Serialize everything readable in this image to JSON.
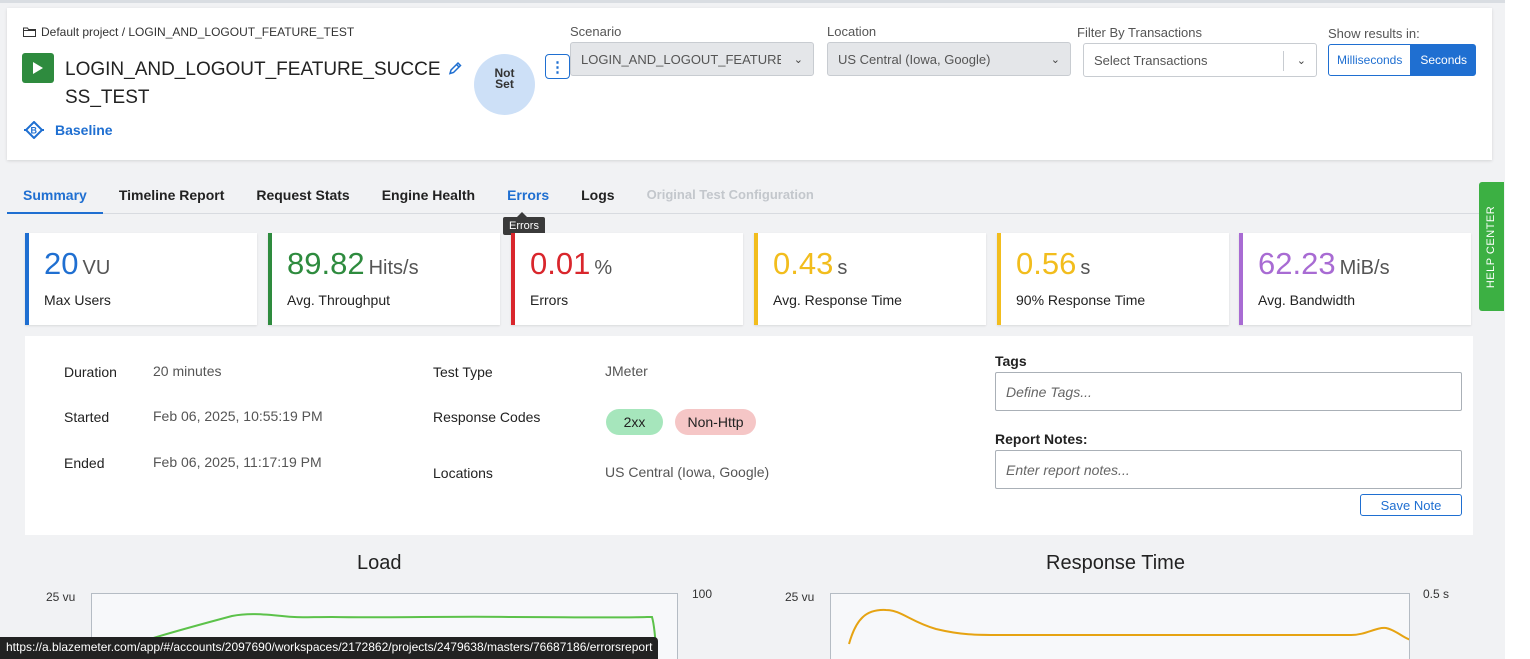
{
  "breadcrumb": "Default project / LOGIN_AND_LOGOUT_FEATURE_TEST",
  "test": {
    "title": "LOGIN_AND_LOGOUT_FEATURE_SUCCESS_TEST",
    "status_line1": "Not",
    "status_line2": "Set",
    "kebab": "⋮",
    "baseline_label": "Baseline"
  },
  "filters": {
    "scenario_label": "Scenario",
    "scenario_value": "LOGIN_AND_LOGOUT_FEATURE_TEST",
    "location_label": "Location",
    "location_value": "US Central (Iowa, Google)",
    "transactions_label": "Filter By Transactions",
    "transactions_placeholder": "Select Transactions",
    "units_label": "Show results in:",
    "units": [
      "Milliseconds",
      "Seconds"
    ],
    "units_selected": "Seconds"
  },
  "tabs": [
    {
      "label": "Summary",
      "state": "active"
    },
    {
      "label": "Timeline Report",
      "state": "normal"
    },
    {
      "label": "Request Stats",
      "state": "normal"
    },
    {
      "label": "Engine Health",
      "state": "normal"
    },
    {
      "label": "Errors",
      "state": "hover"
    },
    {
      "label": "Logs",
      "state": "normal"
    },
    {
      "label": "Original Test Configuration",
      "state": "disabled"
    }
  ],
  "tooltip": "Errors",
  "kpis": [
    {
      "value": "20",
      "unit": "VU",
      "label": "Max Users",
      "color": "#1f6fd1"
    },
    {
      "value": "89.82",
      "unit": "Hits/s",
      "label": "Avg. Throughput",
      "color": "#2e8b3e"
    },
    {
      "value": "0.01",
      "unit": "%",
      "label": "Errors",
      "color": "#d9262c"
    },
    {
      "value": "0.43",
      "unit": "s",
      "label": "Avg. Response Time",
      "color": "#f2bd1d"
    },
    {
      "value": "0.56",
      "unit": "s",
      "label": "90% Response Time",
      "color": "#f2bd1d"
    },
    {
      "value": "62.23",
      "unit": "MiB/s",
      "label": "Avg. Bandwidth",
      "color": "#a86bd3"
    }
  ],
  "help_center": "HELP CENTER",
  "details": {
    "duration_label": "Duration",
    "duration_value": "20 minutes",
    "started_label": "Started",
    "started_value": "Feb 06, 2025, 10:55:19 PM",
    "ended_label": "Ended",
    "ended_value": "Feb 06, 2025, 11:17:19 PM",
    "test_type_label": "Test Type",
    "test_type_value": "JMeter",
    "response_codes_label": "Response Codes",
    "response_codes": [
      {
        "label": "2xx",
        "color": "#a6e6bc"
      },
      {
        "label": "Non-Http",
        "color": "#f5c6c6"
      }
    ],
    "locations_label": "Locations",
    "locations_value": "US Central (Iowa, Google)",
    "tags_label": "Tags",
    "tags_placeholder": "Define Tags...",
    "notes_label": "Report Notes:",
    "notes_placeholder": "Enter report notes...",
    "save_note": "Save Note"
  },
  "charts": {
    "load": {
      "title": "Load",
      "left_axis_top": "25 vu",
      "right_axis_top": "100",
      "line_color": "#5cc24a"
    },
    "response": {
      "title": "Response Time",
      "left_axis_top": "25 vu",
      "right_axis_top": "0.5 s",
      "line_color": "#e6a312"
    }
  },
  "status_url": "https://a.blazemeter.com/app/#/accounts/2097690/workspaces/2172862/projects/2479638/masters/76687186/errorsreport"
}
